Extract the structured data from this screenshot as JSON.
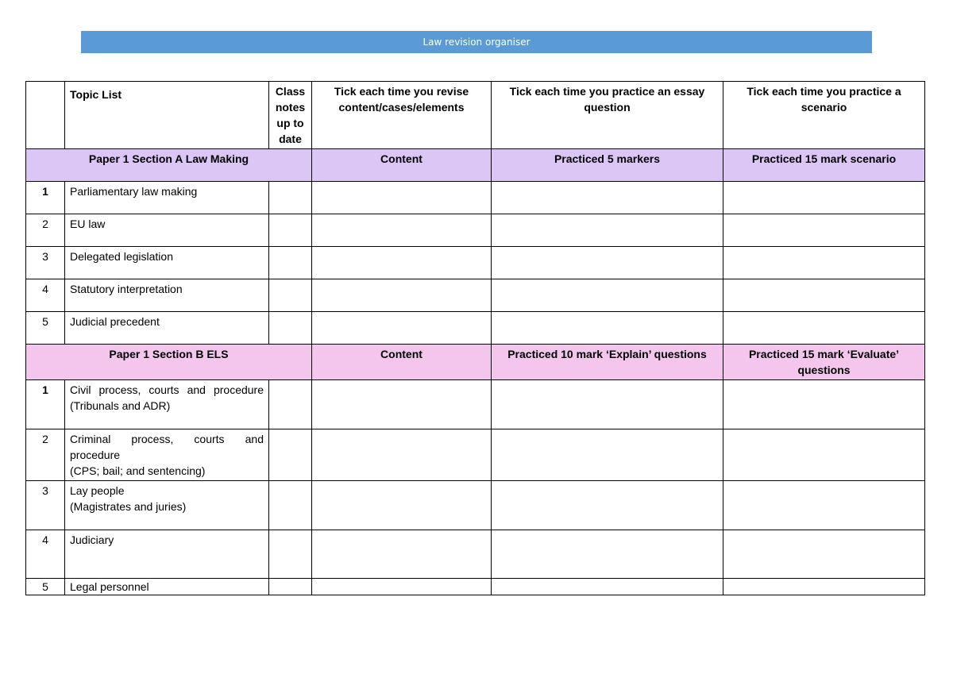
{
  "banner": {
    "title": "Law revision organiser"
  },
  "header": {
    "topic_list": "Topic List",
    "class_notes": "Class notes up to date",
    "tick_revise": "Tick each time you revise content/cases/elements",
    "tick_essay": "Tick each time you practice an essay question",
    "tick_scenario": "Tick each time you practice a scenario"
  },
  "section_a": {
    "title": "Paper 1  Section A Law Making",
    "col_content": "Content",
    "col_essay": "Practiced 5 markers",
    "col_scenario": "Practiced 15 mark scenario",
    "rows": [
      {
        "num": "1",
        "topic": "Parliamentary law making"
      },
      {
        "num": "2",
        "topic": "EU law"
      },
      {
        "num": "3",
        "topic": "Delegated legislation"
      },
      {
        "num": "4",
        "topic": "Statutory interpretation"
      },
      {
        "num": "5",
        "topic": "Judicial precedent"
      }
    ]
  },
  "section_b": {
    "title": "Paper 1 Section  B ELS",
    "col_content": "Content",
    "col_essay": "Practiced 10 mark ‘Explain’ questions",
    "col_scenario": "Practiced 15 mark ‘Evaluate’ questions",
    "rows": [
      {
        "num": "1",
        "topic": "Civil process, courts and procedure (Tribunals and ADR)"
      },
      {
        "num": "2",
        "topic": "Criminal process, courts and procedure",
        "sub": "(CPS; bail; and sentencing)"
      },
      {
        "num": "3",
        "topic": "Lay people",
        "sub": "(Magistrates and juries)"
      },
      {
        "num": "4",
        "topic": "Judiciary"
      },
      {
        "num": "5",
        "topic": "Legal personnel"
      }
    ]
  }
}
